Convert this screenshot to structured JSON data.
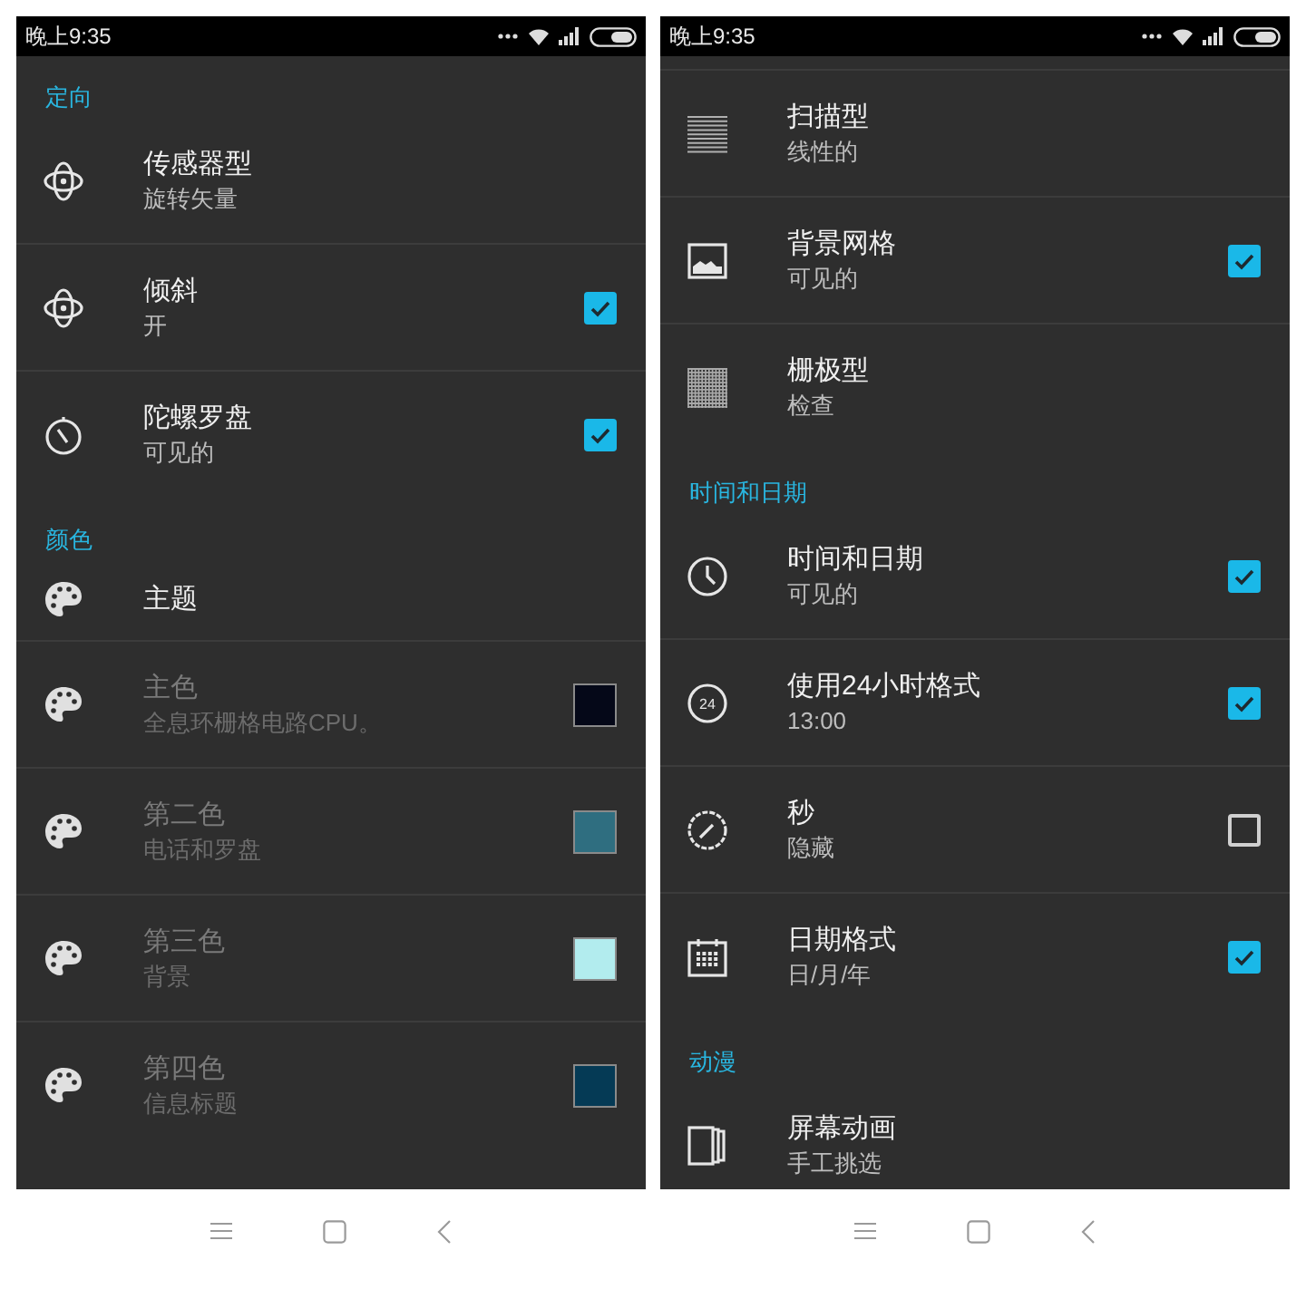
{
  "screens": [
    {
      "status_bar": {
        "time": "晚上9:35"
      },
      "top_cut_row": false,
      "sections": [
        {
          "header": "定向",
          "items": [
            {
              "title": "传感器型",
              "subtitle": "旋转矢量",
              "kind": "plain",
              "disabled": false
            },
            {
              "title": "倾斜",
              "subtitle": "开",
              "kind": "checkbox",
              "checked": true,
              "disabled": false
            },
            {
              "title": "陀螺罗盘",
              "subtitle": "可见的",
              "kind": "checkbox",
              "checked": true,
              "disabled": false
            }
          ]
        },
        {
          "header": "颜色",
          "items": [
            {
              "title": "主题",
              "kind": "plain",
              "disabled": false
            },
            {
              "title": "主色",
              "subtitle": "全息环栅格电路CPU。",
              "kind": "swatch",
              "color": "#050818",
              "disabled": true
            },
            {
              "title": "第二色",
              "subtitle": "电话和罗盘",
              "kind": "swatch",
              "color": "#2f6e80",
              "disabled": true
            },
            {
              "title": "第三色",
              "subtitle": "背景",
              "kind": "swatch",
              "color": "#b2ecee",
              "disabled": true
            },
            {
              "title": "第四色",
              "subtitle": "信息标题",
              "kind": "swatch",
              "color": "#053a55",
              "disabled": true
            }
          ]
        }
      ]
    },
    {
      "status_bar": {
        "time": "晚上9:35"
      },
      "top_cut_row": true,
      "sections": [
        {
          "items": [
            {
              "title": "扫描型",
              "subtitle": "线性的",
              "kind": "plain",
              "disabled": false
            },
            {
              "title": "背景网格",
              "subtitle": "可见的",
              "kind": "checkbox",
              "checked": true,
              "disabled": false
            },
            {
              "title": "栅极型",
              "subtitle": "检查",
              "kind": "plain",
              "disabled": false
            }
          ]
        },
        {
          "header": "时间和日期",
          "items": [
            {
              "title": "时间和日期",
              "subtitle": "可见的",
              "kind": "checkbox",
              "checked": true,
              "disabled": false
            },
            {
              "title": "使用24小时格式",
              "subtitle": "13:00",
              "icon_label": "24",
              "kind": "checkbox",
              "checked": true,
              "disabled": false
            },
            {
              "title": "秒",
              "subtitle": "隐藏",
              "kind": "checkbox",
              "checked": false,
              "disabled": false
            },
            {
              "title": "日期格式",
              "subtitle": "日/月/年",
              "kind": "checkbox",
              "checked": true,
              "disabled": false
            }
          ]
        },
        {
          "header": "动漫",
          "items": [
            {
              "title": "屏幕动画",
              "subtitle": "手工挑选",
              "kind": "plain",
              "disabled": false
            }
          ]
        }
      ]
    }
  ]
}
